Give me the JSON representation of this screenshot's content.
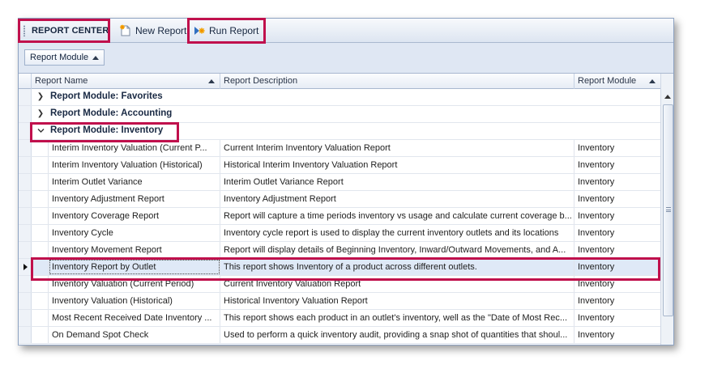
{
  "toolbar": {
    "title": "REPORT CENTER",
    "new_report_label": "New Report",
    "run_report_label": "Run Report",
    "new_report_icon": "new-report-icon",
    "run_report_icon": "run-icon"
  },
  "group_panel": {
    "chip_label": "Report Module"
  },
  "columns": {
    "name": "Report Name",
    "description": "Report Description",
    "module": "Report Module"
  },
  "groups": [
    {
      "label": "Report Module: Favorites",
      "expanded": false
    },
    {
      "label": "Report Module: Accounting",
      "expanded": false
    },
    {
      "label": "Report Module: Inventory",
      "expanded": true
    }
  ],
  "rows": [
    {
      "name": "Interim Inventory Valuation (Current P...",
      "description": "Current Interim Inventory Valuation Report",
      "module": "Inventory"
    },
    {
      "name": "Interim Inventory Valuation (Historical)",
      "description": "Historical Interim Inventory Valuation Report",
      "module": "Inventory"
    },
    {
      "name": "Interim Outlet Variance",
      "description": "Interim Outlet Variance Report",
      "module": "Inventory"
    },
    {
      "name": "Inventory Adjustment Report",
      "description": "Inventory Adjustment Report",
      "module": "Inventory"
    },
    {
      "name": "Inventory Coverage Report",
      "description": "Report will capture a time periods inventory vs usage and calculate current coverage b...",
      "module": "Inventory"
    },
    {
      "name": "Inventory Cycle",
      "description": "Inventory cycle report is used to display the current inventory outlets and its locations",
      "module": "Inventory"
    },
    {
      "name": "Inventory Movement Report",
      "description": "Report will display details of Beginning Inventory, Inward/Outward Movements, and A...",
      "module": "Inventory"
    },
    {
      "name": "Inventory Report by Outlet",
      "description": "This report shows Inventory of a product across different outlets.",
      "module": "Inventory"
    },
    {
      "name": "Inventory Valuation (Current Period)",
      "description": "Current Inventory Valuation Report",
      "module": "Inventory"
    },
    {
      "name": "Inventory Valuation (Historical)",
      "description": "Historical Inventory Valuation Report",
      "module": "Inventory"
    },
    {
      "name": "Most Recent Received Date Inventory ...",
      "description": "This report shows each product in an outlet's inventory, well as the \"Date of Most Rec...",
      "module": "Inventory"
    },
    {
      "name": "On Demand Spot Check",
      "description": "Used to perform a quick inventory audit, providing a snap shot of quantities that shoul...",
      "module": "Inventory"
    }
  ],
  "selected_row_index": 7,
  "colors": {
    "highlight": "#c0104c",
    "selected_row": "#dfe9f7",
    "toolbar_bg": "#dde5f1"
  }
}
